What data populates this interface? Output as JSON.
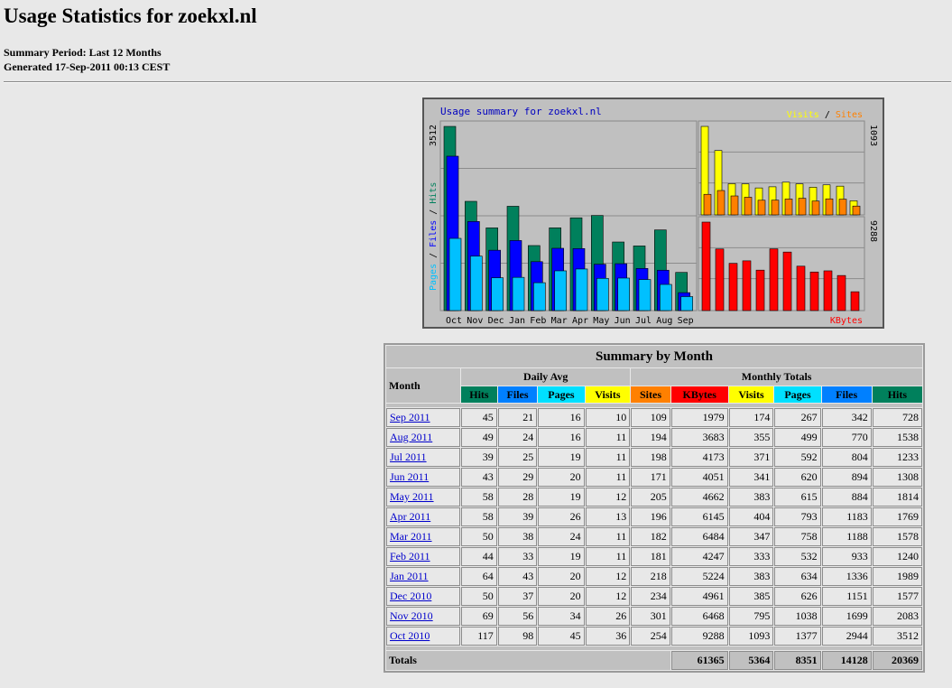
{
  "page": {
    "title": "Usage Statistics for zoekxl.nl",
    "period": "Summary Period: Last 12 Months",
    "generated": "Generated 17-Sep-2011 00:13 CEST"
  },
  "colors": {
    "hits": "#00805c",
    "files": "#0000ff",
    "pages": "#00c0ff",
    "visits": "#ffff00",
    "sites": "#ff8000",
    "kbytes": "#ff0000"
  },
  "chart_data": {
    "type": "bar",
    "title": "Usage summary for zoekxl.nl",
    "categories": [
      "Oct",
      "Nov",
      "Dec",
      "Jan",
      "Feb",
      "Mar",
      "Apr",
      "May",
      "Jun",
      "Jul",
      "Aug",
      "Sep"
    ],
    "left_panel": {
      "ymax_label": "3512",
      "ymax": 3512,
      "axis_label_parts": [
        "Pages",
        "Files",
        "Hits"
      ],
      "series": [
        {
          "name": "Hits",
          "values": [
            3512,
            2083,
            1577,
            1989,
            1240,
            1578,
            1769,
            1814,
            1308,
            1233,
            1538,
            728
          ]
        },
        {
          "name": "Files",
          "values": [
            2944,
            1699,
            1151,
            1336,
            933,
            1188,
            1183,
            884,
            894,
            804,
            770,
            342
          ]
        },
        {
          "name": "Pages",
          "values": [
            1377,
            1038,
            626,
            634,
            532,
            758,
            793,
            615,
            620,
            592,
            499,
            267
          ]
        }
      ]
    },
    "top_right_panel": {
      "ymax_label": "1093",
      "ymax": 1093,
      "legend_parts": [
        "Visits",
        "Sites"
      ],
      "series": [
        {
          "name": "Visits",
          "values": [
            1093,
            795,
            385,
            383,
            333,
            347,
            404,
            383,
            341,
            371,
            355,
            174
          ]
        },
        {
          "name": "Sites",
          "values": [
            254,
            301,
            234,
            218,
            181,
            182,
            196,
            205,
            171,
            198,
            194,
            109
          ]
        }
      ]
    },
    "bottom_right_panel": {
      "ymax_label": "9288",
      "ymax": 9288,
      "legend": "KBytes",
      "series": [
        {
          "name": "KBytes",
          "values": [
            9288,
            6468,
            4961,
            5224,
            4247,
            6484,
            6145,
            4662,
            4051,
            4173,
            3683,
            1979
          ]
        }
      ]
    }
  },
  "table": {
    "caption": "Summary by Month",
    "month_header": "Month",
    "daily_avg_header": "Daily Avg",
    "monthly_totals_header": "Monthly Totals",
    "columns": [
      "Hits",
      "Files",
      "Pages",
      "Visits",
      "Sites",
      "KBytes",
      "Visits",
      "Pages",
      "Files",
      "Hits"
    ],
    "rows": [
      {
        "month": "Sep 2011",
        "cells": [
          "45",
          "21",
          "16",
          "10",
          "109",
          "1979",
          "174",
          "267",
          "342",
          "728"
        ]
      },
      {
        "month": "Aug 2011",
        "cells": [
          "49",
          "24",
          "16",
          "11",
          "194",
          "3683",
          "355",
          "499",
          "770",
          "1538"
        ]
      },
      {
        "month": "Jul 2011",
        "cells": [
          "39",
          "25",
          "19",
          "11",
          "198",
          "4173",
          "371",
          "592",
          "804",
          "1233"
        ]
      },
      {
        "month": "Jun 2011",
        "cells": [
          "43",
          "29",
          "20",
          "11",
          "171",
          "4051",
          "341",
          "620",
          "894",
          "1308"
        ]
      },
      {
        "month": "May 2011",
        "cells": [
          "58",
          "28",
          "19",
          "12",
          "205",
          "4662",
          "383",
          "615",
          "884",
          "1814"
        ]
      },
      {
        "month": "Apr 2011",
        "cells": [
          "58",
          "39",
          "26",
          "13",
          "196",
          "6145",
          "404",
          "793",
          "1183",
          "1769"
        ]
      },
      {
        "month": "Mar 2011",
        "cells": [
          "50",
          "38",
          "24",
          "11",
          "182",
          "6484",
          "347",
          "758",
          "1188",
          "1578"
        ]
      },
      {
        "month": "Feb 2011",
        "cells": [
          "44",
          "33",
          "19",
          "11",
          "181",
          "4247",
          "333",
          "532",
          "933",
          "1240"
        ]
      },
      {
        "month": "Jan 2011",
        "cells": [
          "64",
          "43",
          "20",
          "12",
          "218",
          "5224",
          "383",
          "634",
          "1336",
          "1989"
        ]
      },
      {
        "month": "Dec 2010",
        "cells": [
          "50",
          "37",
          "20",
          "12",
          "234",
          "4961",
          "385",
          "626",
          "1151",
          "1577"
        ]
      },
      {
        "month": "Nov 2010",
        "cells": [
          "69",
          "56",
          "34",
          "26",
          "301",
          "6468",
          "795",
          "1038",
          "1699",
          "2083"
        ]
      },
      {
        "month": "Oct 2010",
        "cells": [
          "117",
          "98",
          "45",
          "36",
          "254",
          "9288",
          "1093",
          "1377",
          "2944",
          "3512"
        ]
      }
    ],
    "totals": {
      "label": "Totals",
      "kbytes": "61365",
      "visits": "5364",
      "pages": "8351",
      "files": "14128",
      "hits": "20369"
    }
  }
}
